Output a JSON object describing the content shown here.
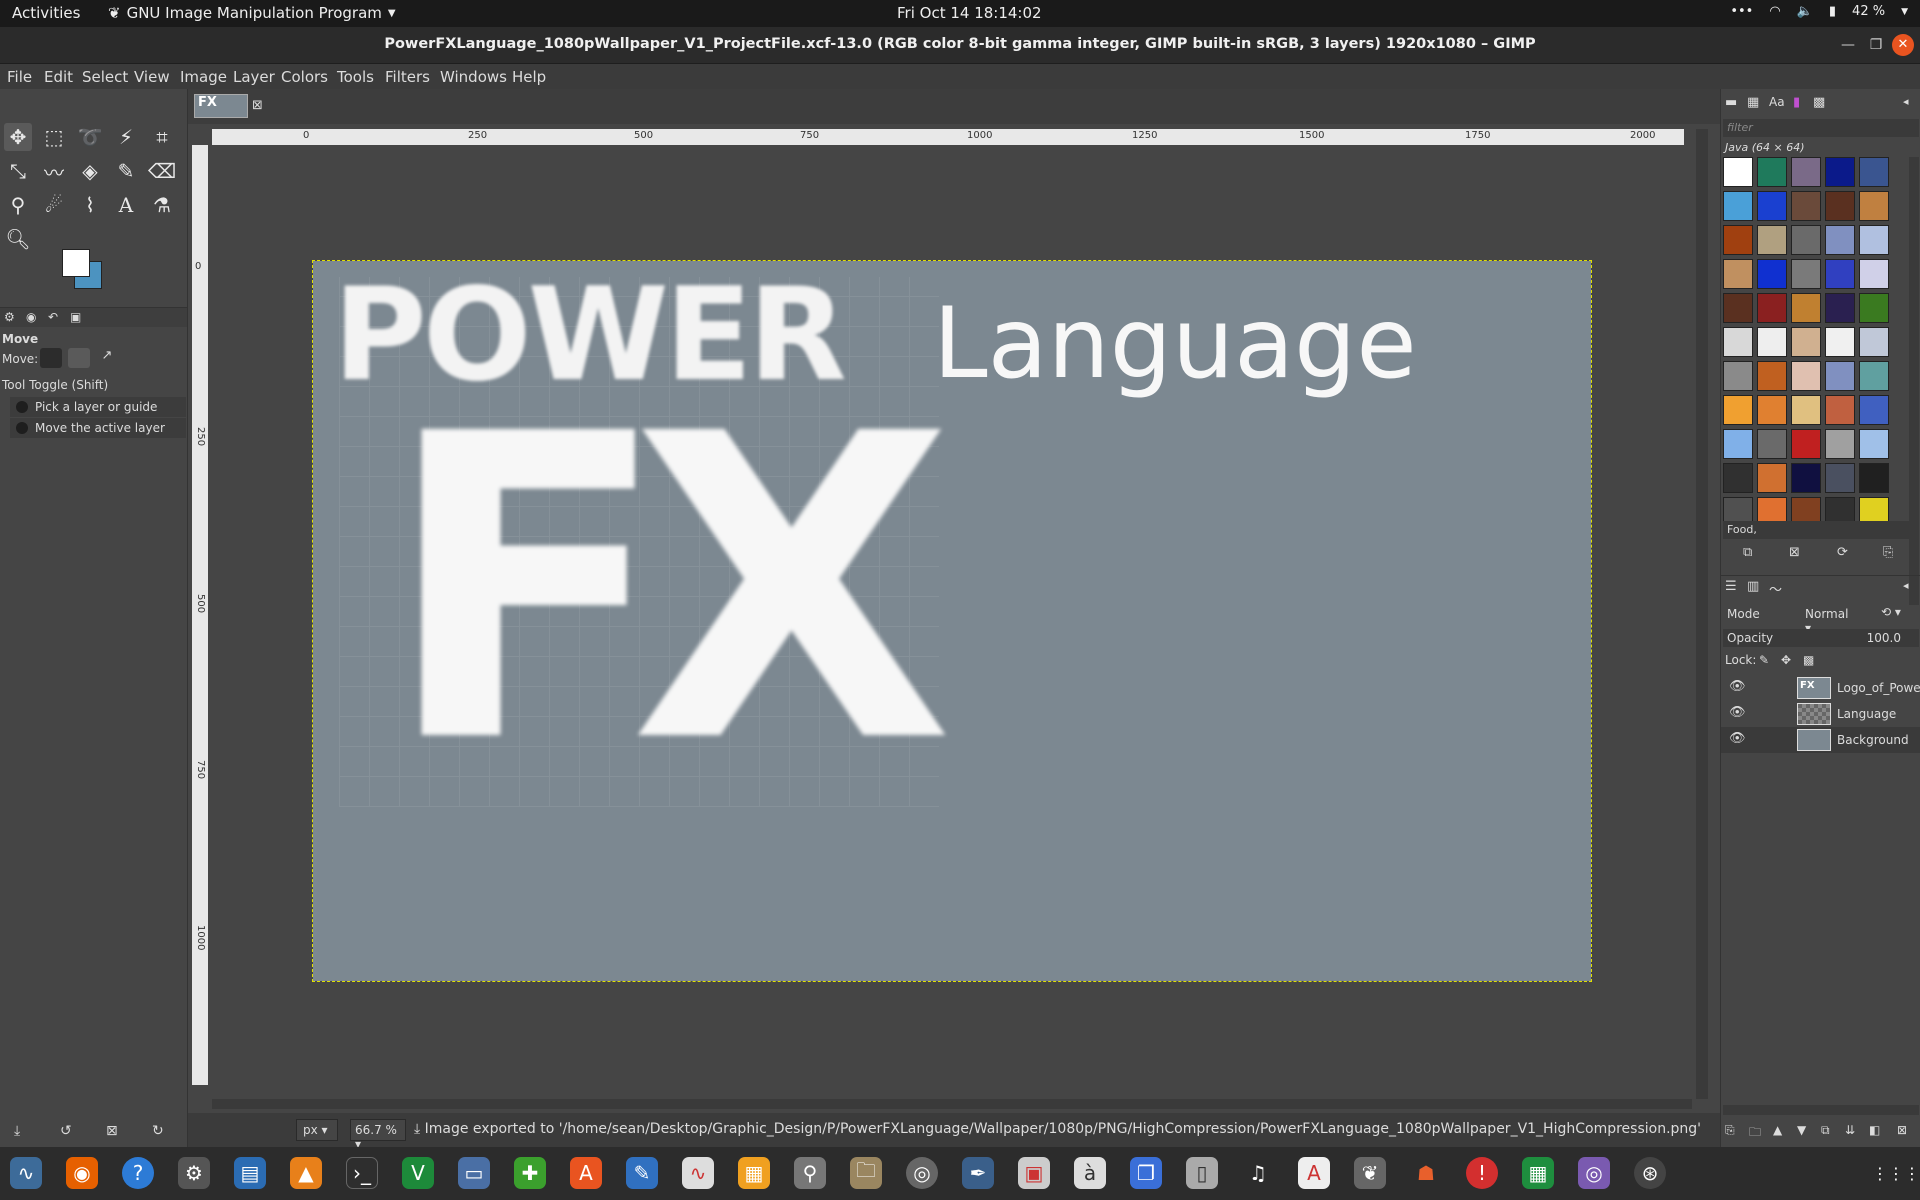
{
  "topbar": {
    "activities": "Activities",
    "app": "GNU Image Manipulation Program",
    "clock": "Fri Oct 14  18:14:02",
    "battery": "42 %"
  },
  "window": {
    "title": "PowerFXLanguage_1080pWallpaper_V1_ProjectFile.xcf-13.0 (RGB color 8-bit gamma integer, GIMP built-in sRGB, 3 layers) 1920x1080 – GIMP"
  },
  "menu": [
    "File",
    "Edit",
    "Select",
    "View",
    "Image",
    "Layer",
    "Colors",
    "Tools",
    "Filters",
    "Windows",
    "Help"
  ],
  "tool_options": {
    "title": "Move",
    "move_label": "Move:",
    "toggle_label": "Tool Toggle  (Shift)",
    "option1": "Pick a layer or guide",
    "option2": "Move the active layer"
  },
  "ruler": {
    "h_ticks": [
      "0",
      "250",
      "500",
      "750",
      "1000",
      "1250",
      "1500",
      "1750",
      "2000"
    ],
    "v_ticks": [
      "0",
      "250",
      "500",
      "750",
      "1000"
    ]
  },
  "canvas": {
    "logo_word1": "POWER",
    "logo_word2": "FX",
    "text_layer": "Language",
    "bg_color": "#7c8891"
  },
  "statusbar": {
    "unit": "px",
    "zoom": "66.7 %",
    "message": "Image exported to '/home/sean/Desktop/Graphic_Design/P/PowerFXLanguage/Wallpaper/1080p/PNG/HighCompression/PowerFXLanguage_1080pWallpaper_V1_HighCompression.png'"
  },
  "patterns": {
    "filter_placeholder": "filter",
    "current": "Java (64 × 64)",
    "tag": "Food,"
  },
  "layers": {
    "mode_label": "Mode",
    "mode_value": "Normal",
    "opacity_label": "Opacity",
    "opacity_value": "100.0",
    "lock_label": "Lock:",
    "items": [
      "Logo_of_Powe",
      "Language",
      "Background"
    ]
  }
}
